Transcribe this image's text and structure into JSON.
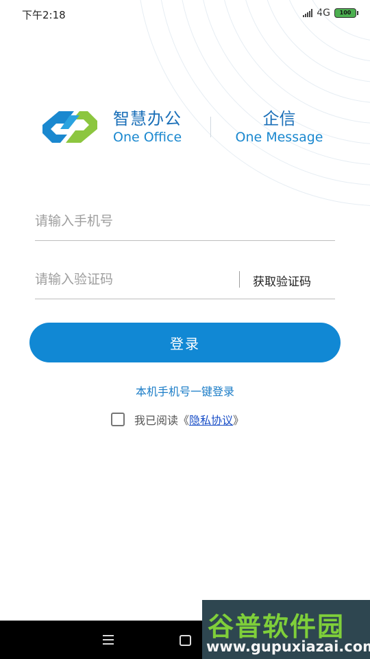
{
  "status_bar": {
    "time": "下午2:18",
    "network": "4G",
    "battery": "100"
  },
  "brand": {
    "product_cn": "智慧办公",
    "product_en": "One Office",
    "partner_cn": "企信",
    "partner_en": "One Message",
    "colors": {
      "green": "#8cc63f",
      "blue": "#1a88cf"
    }
  },
  "form": {
    "phone_placeholder": "请输入手机号",
    "phone_value": "",
    "code_placeholder": "请输入验证码",
    "code_value": "",
    "get_code_label": "获取验证码"
  },
  "login_button": "登录",
  "one_key_login": "本机手机号一键登录",
  "agreement": {
    "checked": false,
    "prefix": "我已阅读《",
    "link": "隐私协议",
    "suffix": "》"
  },
  "nav": {
    "menu_icon": "menu-icon",
    "home_icon": "home-icon"
  },
  "watermark": {
    "cn": "谷普软件园",
    "en": "www.gupuxiazai.com"
  },
  "theme": {
    "accent": "#1188d4",
    "link": "#1a7cc7"
  }
}
